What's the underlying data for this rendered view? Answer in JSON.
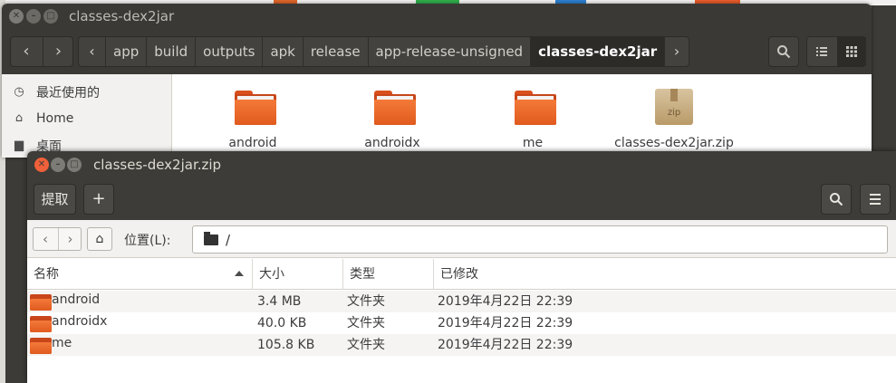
{
  "fm_window": {
    "title": "classes-dex2jar",
    "breadcrumbs": [
      "app",
      "build",
      "outputs",
      "apk",
      "release",
      "app-release-unsigned",
      "classes-dex2jar"
    ],
    "sidebar": [
      {
        "label": "最近使用的",
        "icon": "clock-icon"
      },
      {
        "label": "Home",
        "icon": "home-icon"
      },
      {
        "label": "桌面",
        "icon": "desktop-folder-icon"
      }
    ],
    "files": [
      {
        "name": "android",
        "icon": "folder-icon"
      },
      {
        "name": "androidx",
        "icon": "folder-icon"
      },
      {
        "name": "me",
        "icon": "folder-icon"
      },
      {
        "name": "classes-dex2jar.zip",
        "icon": "zip-archive-icon"
      }
    ],
    "behind_title": "最近使用的"
  },
  "archive_window": {
    "title": "classes-dex2jar.zip",
    "extract_label": "提取",
    "add_label": "+",
    "location_label": "位置(L):",
    "location_value": "/",
    "columns": {
      "name": "名称",
      "size": "大小",
      "type": "类型",
      "modified": "已修改"
    },
    "rows": [
      {
        "name": "android",
        "size": "3.4 MB",
        "type": "文件夹",
        "modified": "2019年4月22日 22:39"
      },
      {
        "name": "androidx",
        "size": "40.0 KB",
        "type": "文件夹",
        "modified": "2019年4月22日 22:39"
      },
      {
        "name": "me",
        "size": "105.8 KB",
        "type": "文件夹",
        "modified": "2019年4月22日 22:39"
      }
    ]
  },
  "colors": {
    "titlebar": "#3d3c38",
    "folder_orange": "#f47a3a",
    "close_button": "#f0603a",
    "selected_crumb": "#2c2b28"
  }
}
